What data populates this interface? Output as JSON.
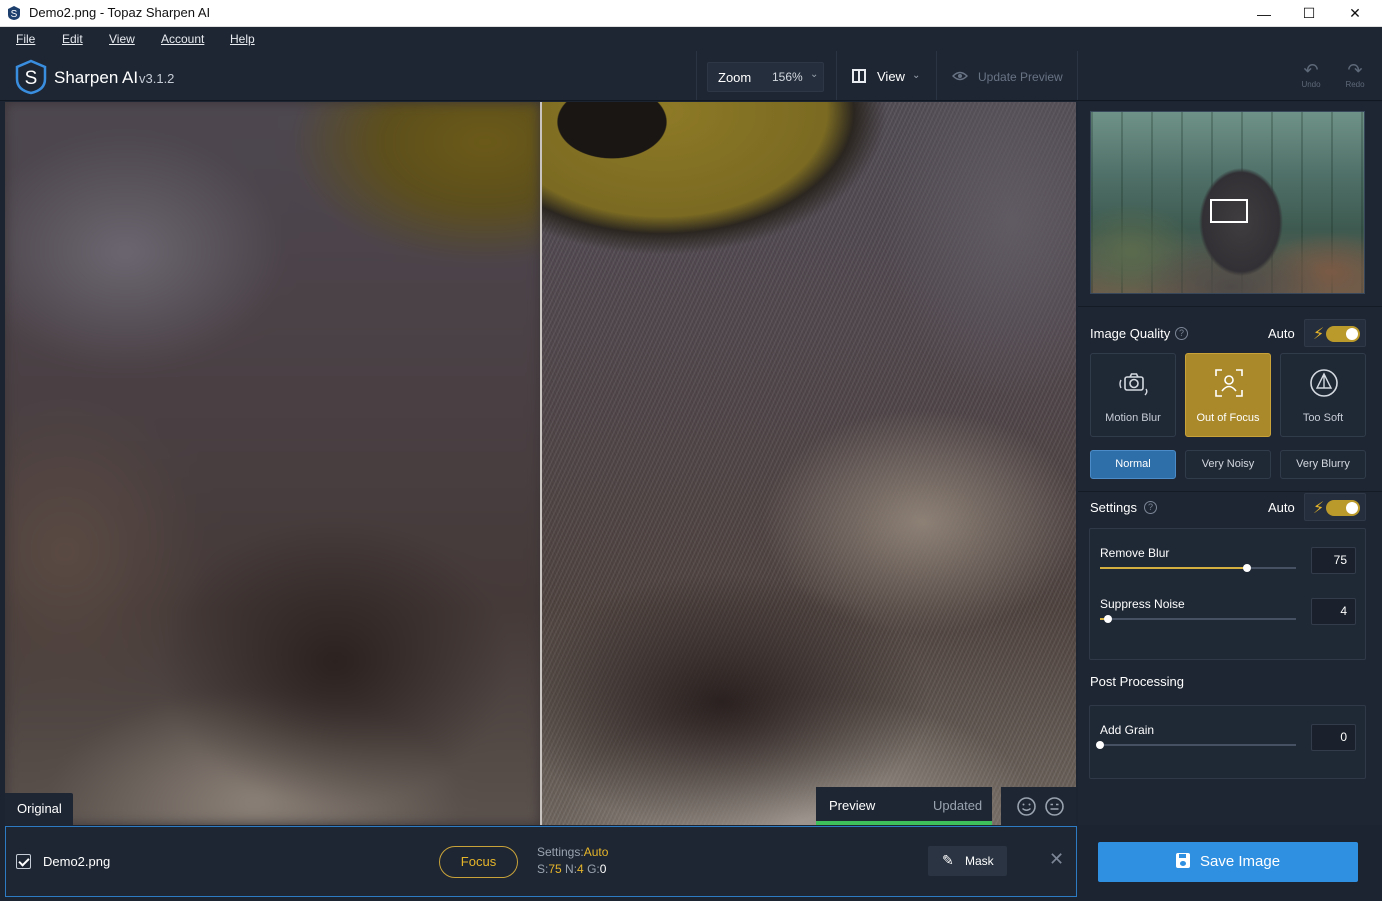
{
  "window": {
    "title": "Demo2.png - Topaz Sharpen AI",
    "controls": {
      "minimize": "—",
      "maximize": "☐",
      "close": "✕"
    }
  },
  "menu": {
    "items": [
      "File",
      "Edit",
      "View",
      "Account",
      "Help"
    ]
  },
  "toolbar": {
    "app_name": "Sharpen AI",
    "version": "v3.1.2",
    "zoom_label": "Zoom",
    "zoom_value": "156%",
    "view_label": "View",
    "update_preview_label": "Update Preview",
    "undo_label": "Undo",
    "redo_label": "Redo"
  },
  "canvas": {
    "original_label": "Original",
    "preview_label": "Preview",
    "preview_status": "Updated",
    "preview_progress_pct": 100
  },
  "panel": {
    "image_quality": {
      "title": "Image Quality",
      "auto_label": "Auto",
      "auto_enabled": true,
      "modes": [
        {
          "label": "Motion Blur",
          "icon": "motion-blur-icon",
          "active": false
        },
        {
          "label": "Out of Focus",
          "icon": "out-of-focus-icon",
          "active": true
        },
        {
          "label": "Too Soft",
          "icon": "too-soft-icon",
          "active": false
        }
      ],
      "noise": [
        {
          "label": "Normal",
          "active": true
        },
        {
          "label": "Very Noisy",
          "active": false
        },
        {
          "label": "Very Blurry",
          "active": false
        }
      ]
    },
    "settings": {
      "title": "Settings",
      "auto_label": "Auto",
      "auto_enabled": true,
      "remove_blur": {
        "label": "Remove Blur",
        "value": "75",
        "level": 0.75
      },
      "suppress_noise": {
        "label": "Suppress Noise",
        "value": "4",
        "level": 0.04
      }
    },
    "post_processing": {
      "title": "Post Processing",
      "add_grain": {
        "label": "Add Grain",
        "value": "0",
        "level": 0.0
      }
    }
  },
  "bottom": {
    "file_name": "Demo2.png",
    "file_checked": true,
    "mode_pill": "Focus",
    "settings_prefix": "Settings:",
    "settings_mode": "Auto",
    "s_label": "S:",
    "s_value": "75",
    "n_label": "N:",
    "n_value": "4",
    "g_label": "G:",
    "g_value": "0",
    "mask_label": "Mask",
    "save_label": "Save Image"
  },
  "colors": {
    "accent_gold": "#e6b52a",
    "accent_blue": "#2f8fe0",
    "panel_bg": "#1e2633",
    "preview_bar": "#3fbf5b"
  }
}
